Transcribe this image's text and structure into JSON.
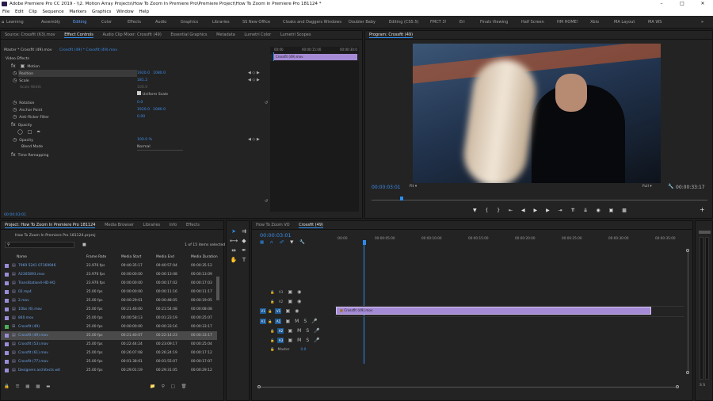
{
  "title": "Adobe Premiere Pro CC 2019 - \\\\2. Motion Array Projects\\How To Zoom In Premiere Pro\\Premiere Project\\How To Zoom in Premiere Pro 181124 *",
  "menu": [
    "File",
    "Edit",
    "Clip",
    "Sequence",
    "Markers",
    "Graphics",
    "Window",
    "Help"
  ],
  "workspaces": [
    "Learning",
    "Assembly",
    "Editing",
    "Color",
    "Effects",
    "Audio",
    "Graphics",
    "Libraries",
    "SS New Office",
    "Cloaks and Daggers Windows",
    "Doubler Baby",
    "Editing (CS5.5)",
    "FMCT 3!",
    "Eri",
    "Finals Viewing",
    "Half Screen",
    "HM HOME!",
    "Xbio",
    "MA Layout",
    "MA WS"
  ],
  "active_workspace": "Editing",
  "source_tabs": [
    "Source: Crossfit (63).mov",
    "Effect Controls",
    "Audio Clip Mixer: Crossfit (49)",
    "Essential Graphics",
    "Metadata",
    "Lumetri Color",
    "Lumetri Scopes"
  ],
  "effect_controls": {
    "master": "Master * Crossfit (49).mov",
    "clip": "Crossfit (49) * Crossfit (49).mov",
    "ruler": [
      "00:00",
      "00:00:15:00",
      "00:00:30:0"
    ],
    "clip_label": "Crossfit (49).mov",
    "video_effects": "Video Effects",
    "motion": "Motion",
    "position_label": "Position",
    "position_x": "1920.0",
    "position_y": "1080.0",
    "scale_label": "Scale",
    "scale_value": "181.2",
    "scale_width_label": "Scale Width",
    "scale_width_value": "100.0",
    "uniform_label": "Uniform Scale",
    "rotation_label": "Rotation",
    "rotation_value": "0.0",
    "anchor_label": "Anchor Point",
    "anchor_x": "1920.0",
    "anchor_y": "1080.0",
    "flicker_label": "Anti-flicker Filter",
    "flicker_value": "0.00",
    "opacity_section": "Opacity",
    "opacity_label": "Opacity",
    "opacity_value": "100.0 %",
    "blend_label": "Blend Mode",
    "blend_value": "Normal",
    "time_remap": "Time Remapping",
    "timecode": "00:00:03:01"
  },
  "program": {
    "tab": "Program: Crossfit (49)",
    "timecode": "00:00:03:01",
    "fit": "Fit",
    "quality": "Full",
    "duration": "00:00:33:17"
  },
  "project": {
    "tabs": [
      "Project: How To Zoom In Premiere Pro 181124",
      "Media Browser",
      "Libraries",
      "Info",
      "Effects"
    ],
    "file": "How To Zoom In Premiere Pro 181124.prproj",
    "selection": "1 of 15 items selected",
    "columns": [
      "Name",
      "Frame Rate",
      "Media Start",
      "Media End",
      "Media Duration"
    ],
    "rows": [
      {
        "name": "7969 5241 07169946",
        "rate": "23.976 fps",
        "start": "09:40:35:17",
        "end": "09:40:57:04",
        "dur": "00:00:35:12",
        "color": "#9b8cd8"
      },
      {
        "name": "A2305893.mov",
        "rate": "23.976 fps",
        "start": "00:00:00:00",
        "end": "00:00:13:08",
        "dur": "00:00:13:09",
        "color": "#9b8cd8"
      },
      {
        "name": "TransStation4-HD-HQ",
        "rate": "23.976 fps",
        "start": "00:00:00:00",
        "end": "00:00:17:02",
        "dur": "00:00:17:03",
        "color": "#9b8cd8"
      },
      {
        "name": "02.mp4",
        "rate": "25.00 fps",
        "start": "00:00:00:00",
        "end": "00:00:11:16",
        "dur": "00:00:11:17",
        "color": "#9b8cd8"
      },
      {
        "name": "2.mov",
        "rate": "25.00 fps",
        "start": "00:00:29:01",
        "end": "00:00:48:05",
        "dur": "00:00:19:05",
        "color": "#9b8cd8"
      },
      {
        "name": "1Obs (6).mov",
        "rate": "25.00 fps",
        "start": "00:21:46:00",
        "end": "00:21:54:08",
        "dur": "00:00:08:08",
        "color": "#9b8cd8"
      },
      {
        "name": "840.mov",
        "rate": "25.00 fps",
        "start": "00:00:58:13",
        "end": "00:01:23:19",
        "dur": "00:00:25:07",
        "color": "#9b8cd8"
      },
      {
        "name": "Crossfit (49)",
        "rate": "25.00 fps",
        "start": "00:00:00:00",
        "end": "00:00:33:16",
        "dur": "00:00:33:17",
        "color": "#4fae5a"
      },
      {
        "name": "Crossfit (49).mov",
        "rate": "25.00 fps",
        "start": "00:21:40:07",
        "end": "00:22:14:23",
        "dur": "00:00:33:17",
        "color": "#9b8cd8"
      },
      {
        "name": "Crossfit (53).mov",
        "rate": "25.00 fps",
        "start": "00:22:44:24",
        "end": "00:23:09:17",
        "dur": "00:00:25:04",
        "color": "#9b8cd8"
      },
      {
        "name": "Crossfit (61).mov",
        "rate": "25.00 fps",
        "start": "00:26:07:08",
        "end": "00:26:24:19",
        "dur": "00:00:17:12",
        "color": "#9b8cd8"
      },
      {
        "name": "Crossfit (77).mov",
        "rate": "25.00 fps",
        "start": "00:01:38:01",
        "end": "00:01:55:07",
        "dur": "00:00:17:07",
        "color": "#9b8cd8"
      },
      {
        "name": "Designers architects wit",
        "rate": "25.00 fps",
        "start": "00:29:01:19",
        "end": "00:29:31:05",
        "dur": "00:00:29:12",
        "color": "#9b8cd8"
      }
    ]
  },
  "timeline": {
    "tabs": [
      "How To Zoom VO",
      "Crossfit (49)"
    ],
    "timecode": "00:00:03:01",
    "ruler": [
      ":00:00",
      "00:00:05:00",
      "00:00:10:00",
      "00:00:15:00",
      "00:00:20:00",
      "00:00:25:00",
      "00:00:30:00",
      "00:00:35:00"
    ],
    "video_tracks": [
      "V3",
      "V2",
      "V1"
    ],
    "audio_tracks": [
      "A1",
      "A2",
      "A3"
    ],
    "clip": "Crossfit (49).mov",
    "master": "Master",
    "master_value": "0.0",
    "src_v": "V1",
    "src_a": "A1"
  },
  "colors": {
    "accent": "#2d8ceb",
    "clip": "#a58ad6",
    "green": "#4fae5a"
  }
}
